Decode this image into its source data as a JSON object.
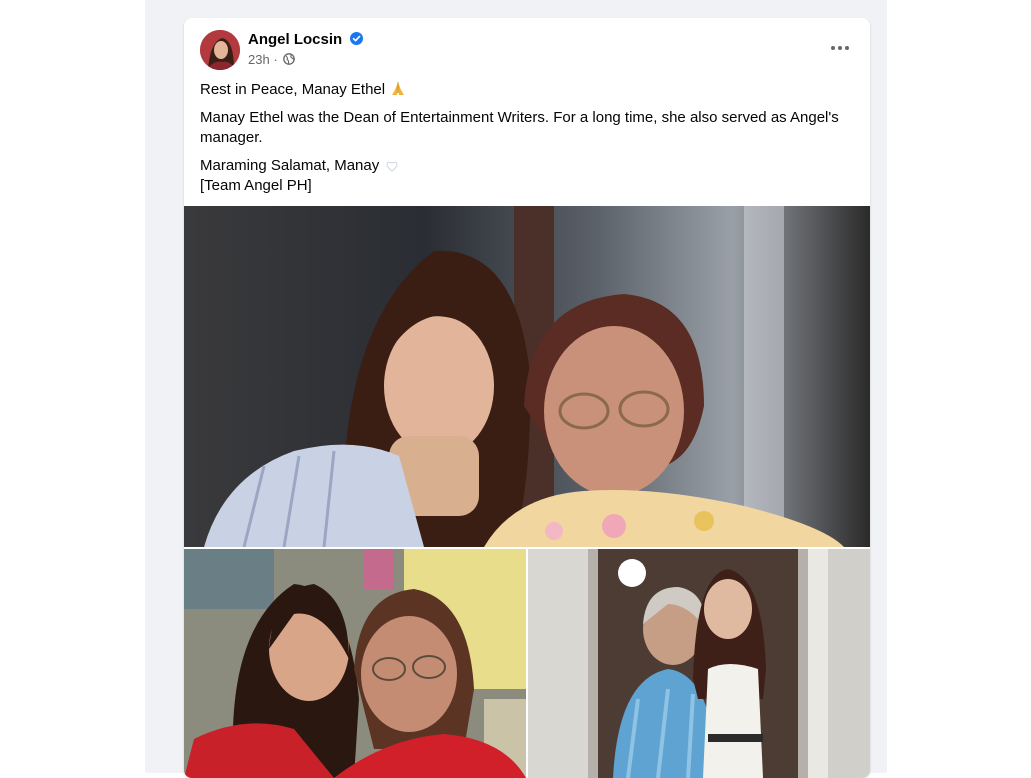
{
  "post": {
    "author": "Angel Locsin",
    "time": "23h",
    "lines": {
      "l1": "Rest in Peace, Manay Ethel",
      "l2": "Manay Ethel was the Dean of Entertainment Writers. For a long time, she also served as Angel's manager.",
      "l3a": "Maraming Salamat, Manay",
      "l3b": "[Team Angel PH]"
    }
  },
  "icons": {
    "verified": "verified-badge-icon",
    "audience": "globe-icon",
    "menu": "more-options-icon",
    "emoji1": "folded-hands-emoji",
    "emoji2": "white-heart-emoji"
  },
  "colors": {
    "verified_blue": "#1877f2",
    "meta_gray": "#65676b",
    "feed_bg": "#f0f2f5"
  }
}
